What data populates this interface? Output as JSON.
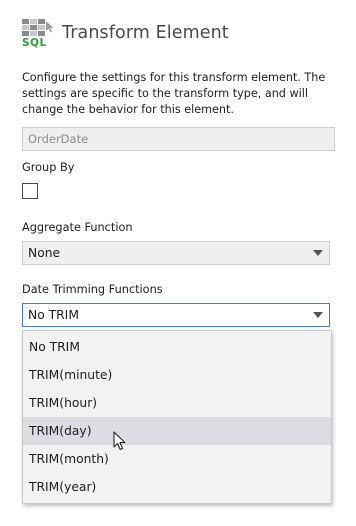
{
  "header": {
    "title": "Transform Element",
    "logo_text": "SQL",
    "logo_icon": "sql-grid-logo",
    "accent_color": "#2f9b3c"
  },
  "description": "Configure the settings for this transform element. The settings are specific to the transform type, and will change the behavior for this element.",
  "element_name_field": {
    "value": "OrderDate"
  },
  "group_by": {
    "label": "Group By",
    "checked": false
  },
  "aggregate_function": {
    "label": "Aggregate Function",
    "selected": "None"
  },
  "date_trimming": {
    "label": "Date Trimming Functions",
    "selected": "No TRIM",
    "options": [
      "No TRIM",
      "TRIM(minute)",
      "TRIM(hour)",
      "TRIM(day)",
      "TRIM(month)",
      "TRIM(year)"
    ],
    "hovered_option": "TRIM(day)"
  }
}
